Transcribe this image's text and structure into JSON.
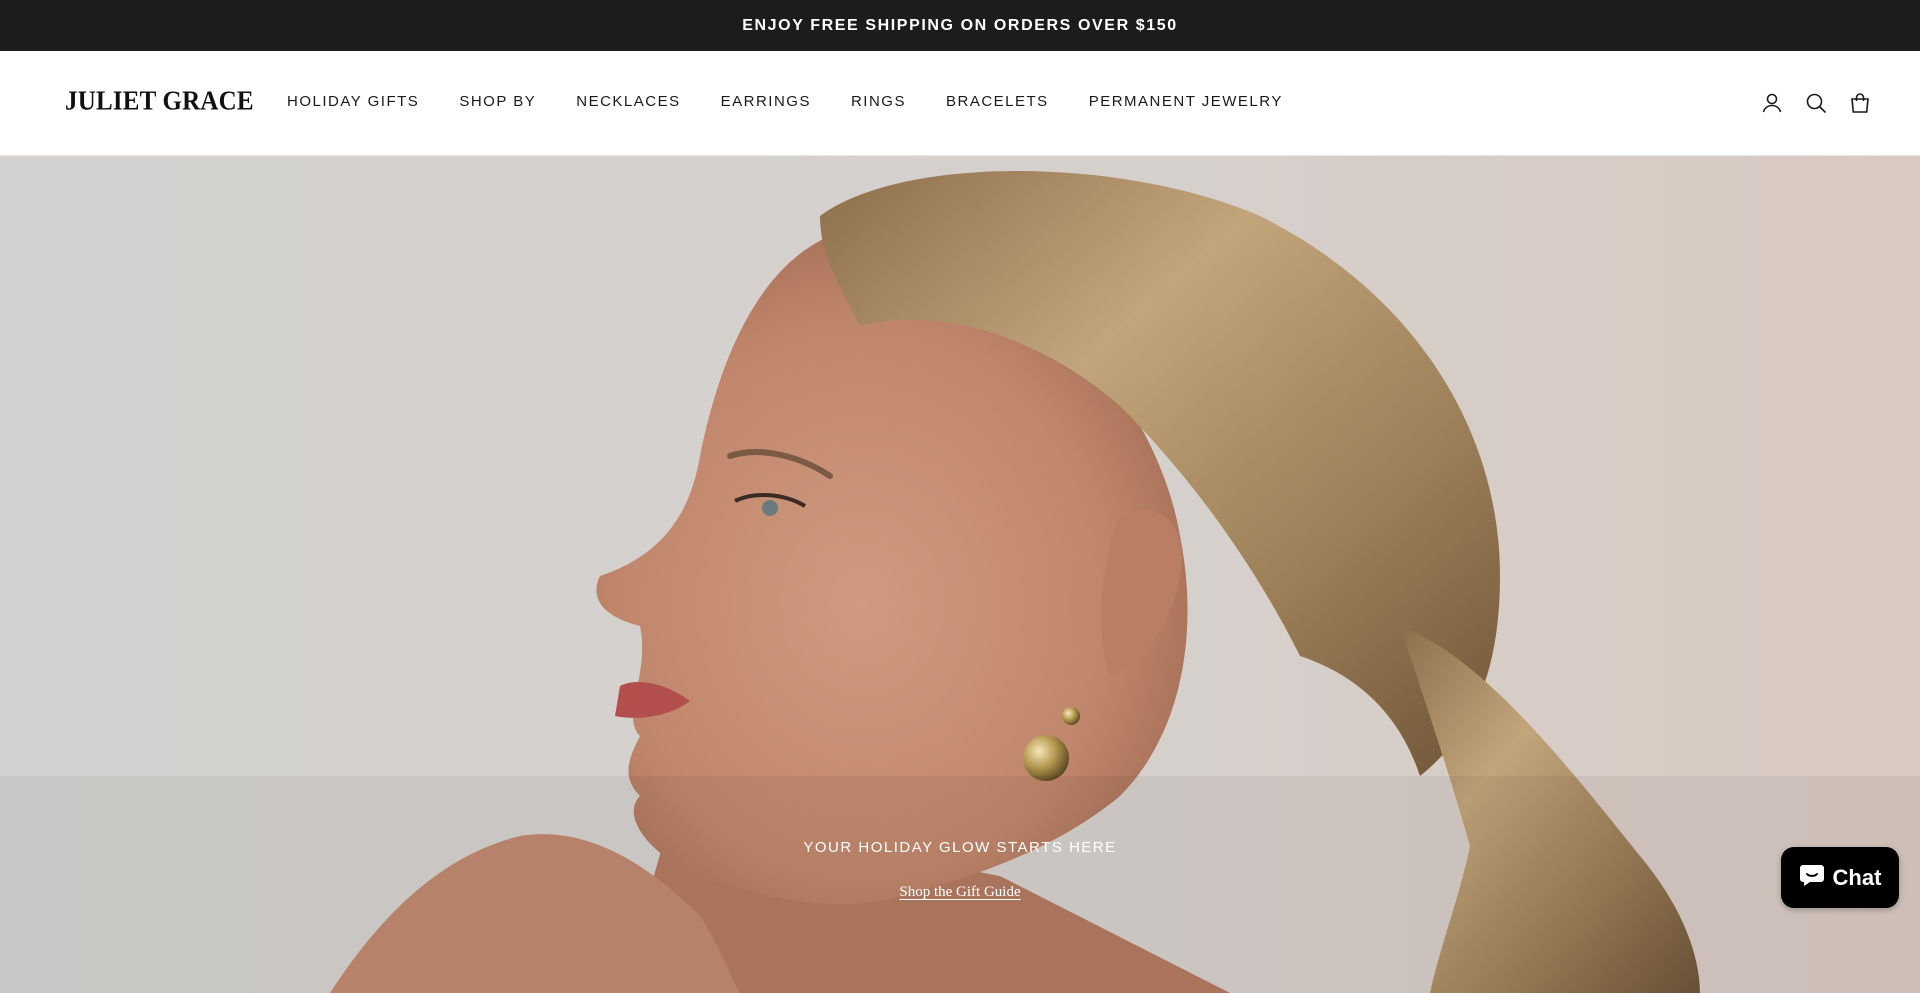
{
  "announcement": {
    "text": "ENJOY FREE SHIPPING ON ORDERS OVER $150"
  },
  "header": {
    "logo": "JULIET GRACE",
    "nav": [
      {
        "label": "HOLIDAY GIFTS"
      },
      {
        "label": "SHOP BY"
      },
      {
        "label": "NECKLACES"
      },
      {
        "label": "EARRINGS"
      },
      {
        "label": "RINGS"
      },
      {
        "label": "BRACELETS"
      },
      {
        "label": "PERMANENT JEWELRY"
      }
    ],
    "icons": [
      "account-icon",
      "search-icon",
      "cart-icon"
    ]
  },
  "hero": {
    "tagline": "YOUR HOLIDAY GLOW STARTS HERE",
    "link": "Shop the Gift Guide"
  },
  "chat": {
    "label": "Chat",
    "icon": "chat-bubble-icon"
  },
  "colors": {
    "announcement_bg": "#1c1c1c",
    "hero_bg": "#d6d3d1",
    "skin": "#c78f73",
    "hair": "#a88b62",
    "gold": "#b79a52"
  }
}
